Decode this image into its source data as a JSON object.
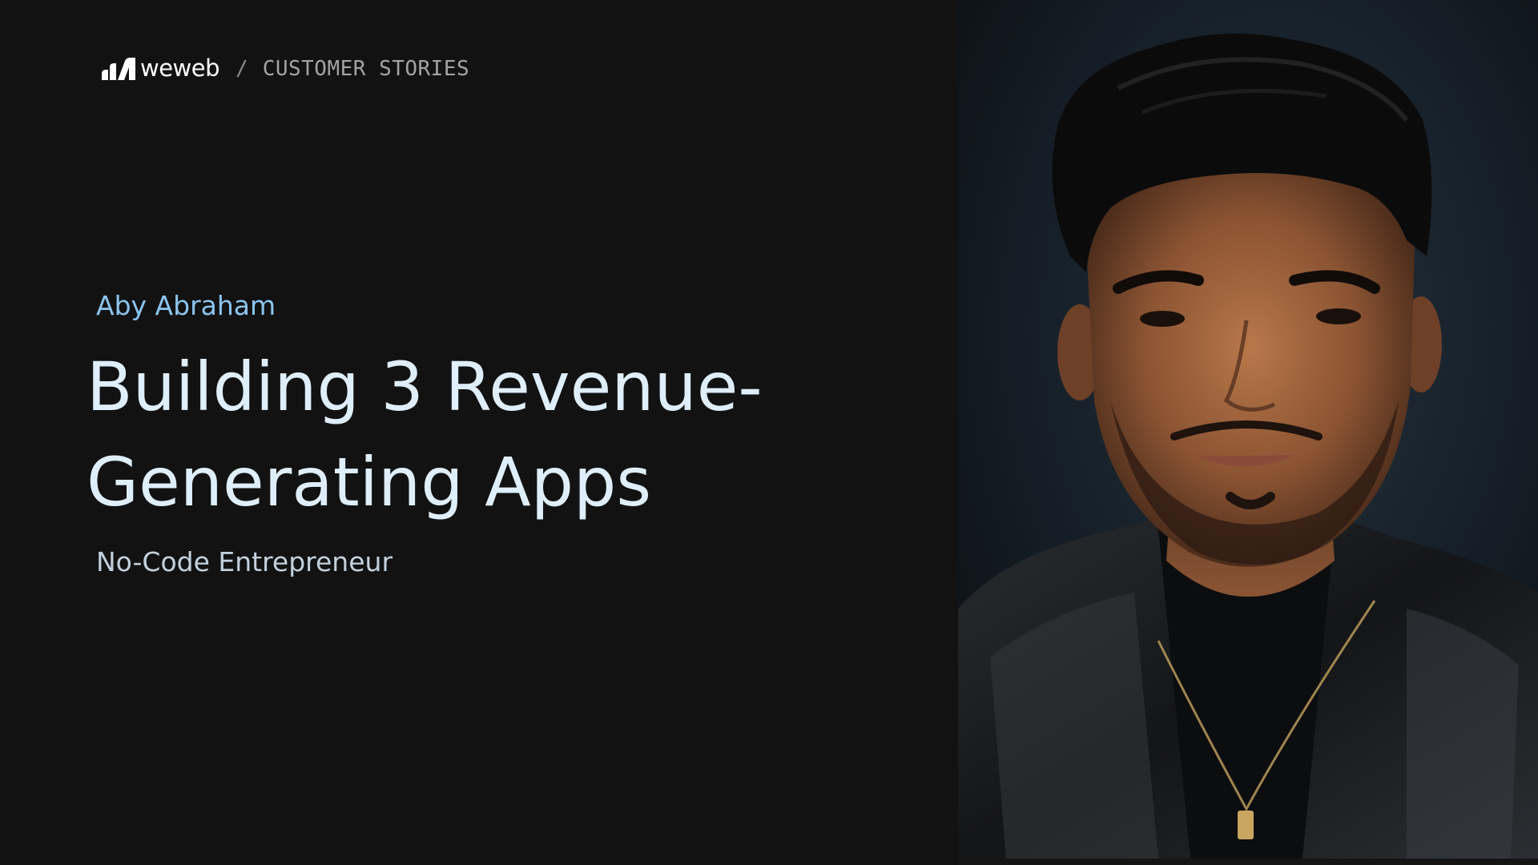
{
  "brand": {
    "logo_text": "weweb",
    "logo_icon": "weweb-logo-icon"
  },
  "breadcrumb": {
    "separator": "/",
    "section": "CUSTOMER STORIES"
  },
  "story": {
    "person_name": "Aby Abraham",
    "headline": "Building 3 Revenue-Generating Apps",
    "role": "No-Code Entrepreneur"
  },
  "colors": {
    "background": "#121212",
    "accent_name": "#8cc4ef",
    "headline": "#dfeefb",
    "role": "#c3d1dd",
    "breadcrumb": "#a3a3a3"
  }
}
